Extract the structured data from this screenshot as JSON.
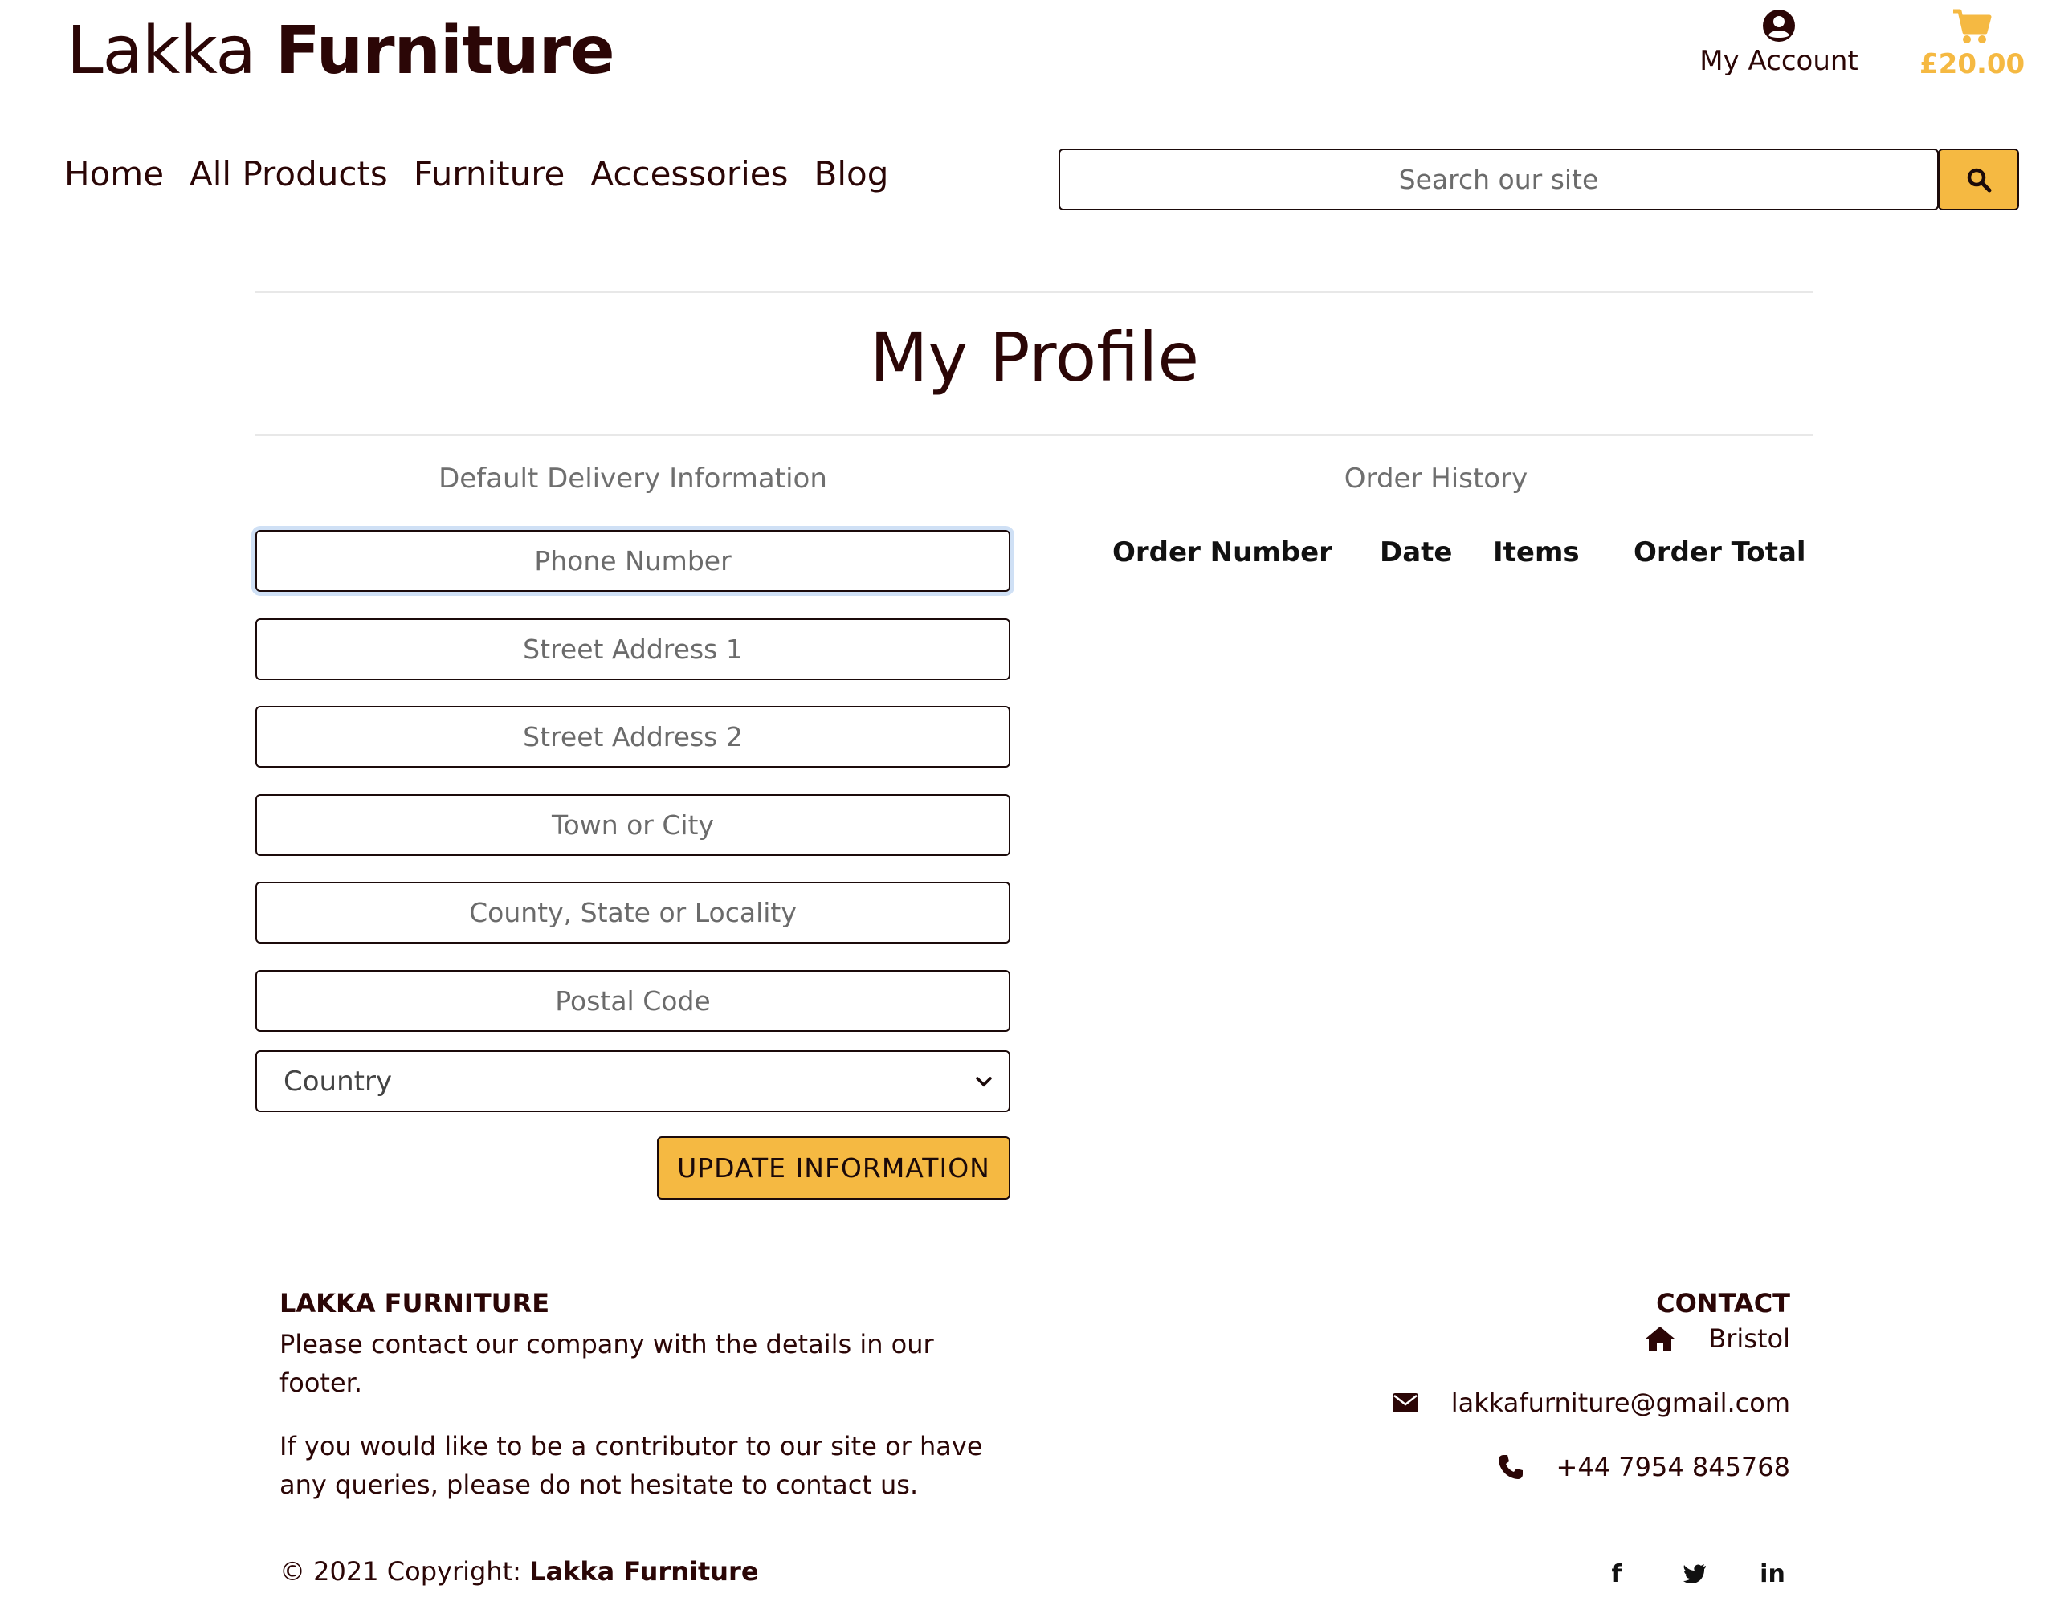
{
  "header": {
    "brand_light": "Lakka",
    "brand_bold": "Furniture",
    "account_label": "My Account",
    "cart_total": "£20.00",
    "icons": {
      "account": "user-circle-icon",
      "cart": "shopping-cart-icon",
      "search": "search-icon"
    }
  },
  "nav": {
    "items": [
      {
        "label": "Home"
      },
      {
        "label": "All Products"
      },
      {
        "label": "Furniture"
      },
      {
        "label": "Accessories"
      },
      {
        "label": "Blog"
      }
    ]
  },
  "search": {
    "placeholder": "Search our site",
    "value": ""
  },
  "page": {
    "title": "My Profile"
  },
  "delivery": {
    "title": "Default Delivery Information",
    "fields": [
      {
        "placeholder": "Phone Number",
        "value": ""
      },
      {
        "placeholder": "Street Address 1",
        "value": ""
      },
      {
        "placeholder": "Street Address 2",
        "value": ""
      },
      {
        "placeholder": "Town or City",
        "value": ""
      },
      {
        "placeholder": "County, State or Locality",
        "value": ""
      },
      {
        "placeholder": "Postal Code",
        "value": ""
      }
    ],
    "country": "Country",
    "update_label": "UPDATE INFORMATION"
  },
  "orders": {
    "title": "Order History",
    "columns": [
      "Order Number",
      "Date",
      "Items",
      "Order Total"
    ],
    "rows": []
  },
  "footer": {
    "brand_heading": "LAKKA FURNITURE",
    "about_1": "Please contact our company with the details in our footer.",
    "about_2": "If you would like to be a contributor to our site or have any queries, please do not hesitate to contact us.",
    "copyright_prefix": "© 2021 Copyright:",
    "copyright_name": "Lakka Furniture",
    "contact_heading": "CONTACT",
    "city": "Bristol",
    "email": "lakkafurniture@gmail.com",
    "phone": "+44 7954 845768",
    "social": [
      {
        "name": "facebook-icon",
        "glyph": "f"
      },
      {
        "name": "twitter-icon",
        "glyph": ""
      },
      {
        "name": "linkedin-icon",
        "glyph": "in"
      }
    ]
  },
  "colors": {
    "brand_text": "#2b0606",
    "accent": "#f5b942",
    "border": "#1b0a0a",
    "muted_text": "#6f6f6f"
  }
}
